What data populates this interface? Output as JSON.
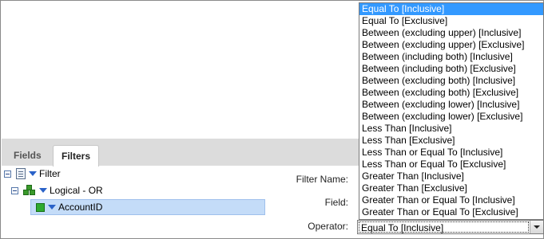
{
  "tabs": [
    {
      "label": "Fields"
    },
    {
      "label": "Filters"
    }
  ],
  "tree": {
    "root": "Filter",
    "group": "Logical - OR",
    "selected": "AccountID"
  },
  "form": {
    "filter_name_label": "Filter Name:",
    "field_label": "Field:",
    "operator_label": "Operator:",
    "operator_value": "Equal To [Inclusive]"
  },
  "operator_options": [
    "Equal To [Inclusive]",
    "Equal To [Exclusive]",
    "Between (excluding upper) [Inclusive]",
    "Between (excluding upper) [Exclusive]",
    "Between (including both) [Inclusive]",
    "Between (including both) [Exclusive]",
    "Between (excluding both) [Inclusive]",
    "Between (excluding both) [Exclusive]",
    "Between (excluding lower) [Inclusive]",
    "Between (excluding lower) [Exclusive]",
    "Less Than [Inclusive]",
    "Less Than [Exclusive]",
    "Less Than or Equal To [Inclusive]",
    "Less Than or Equal To [Exclusive]",
    "Greater Than [Inclusive]",
    "Greater Than [Exclusive]",
    "Greater Than or Equal To [Inclusive]",
    "Greater Than or Equal To [Exclusive]"
  ],
  "colors": {
    "highlight": "#3399ff",
    "selection": "#c4dcf8"
  }
}
